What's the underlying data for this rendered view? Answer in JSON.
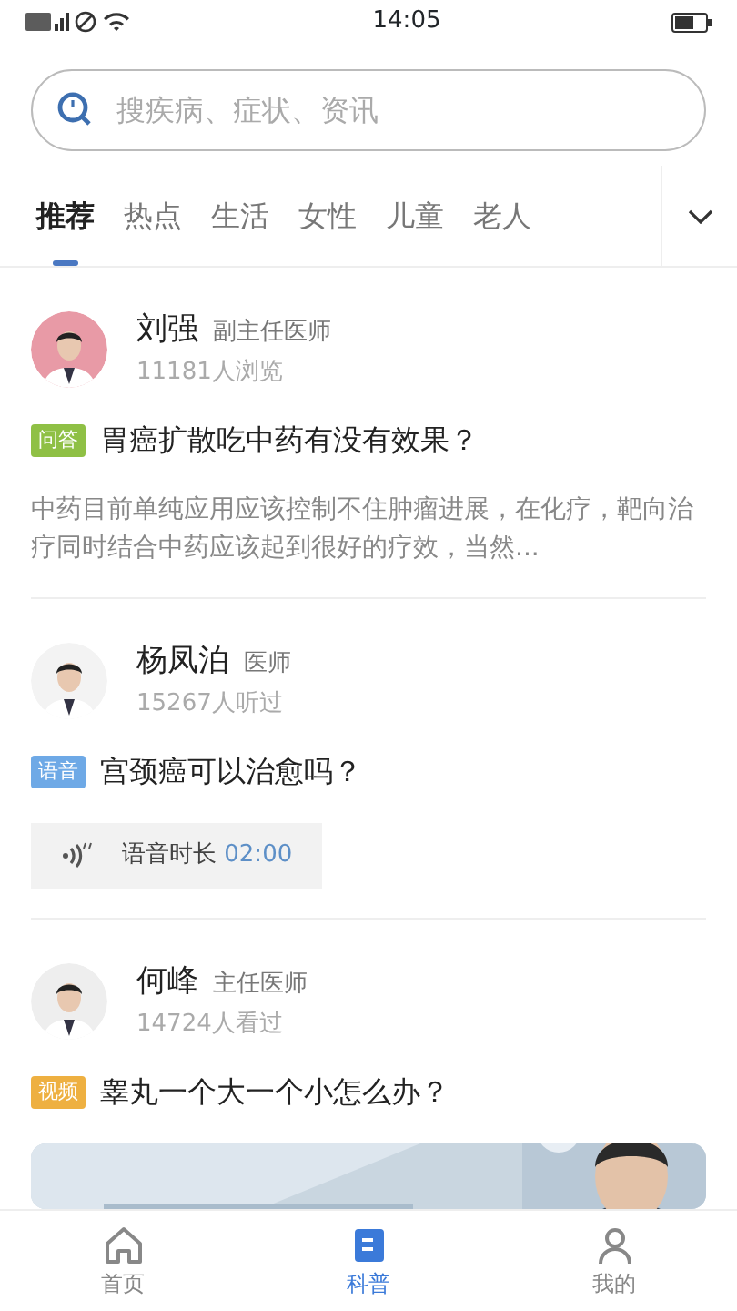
{
  "status_bar": {
    "time": "14:05"
  },
  "search": {
    "placeholder": "搜疾病、症状、资讯"
  },
  "tabs": [
    {
      "label": "推荐",
      "selected": true
    },
    {
      "label": "热点",
      "selected": false
    },
    {
      "label": "生活",
      "selected": false
    },
    {
      "label": "女性",
      "selected": false
    },
    {
      "label": "儿童",
      "selected": false
    },
    {
      "label": "老人",
      "selected": false
    }
  ],
  "feed": [
    {
      "kind": "qa",
      "doctor": "刘强",
      "title": "副主任医师",
      "views": "11181人浏览",
      "tag": "问答",
      "color": "#8fc045",
      "question": "胃癌扩散吃中药有没有效果？",
      "excerpt": "中药目前单纯应用应该控制不住肿瘤进展，在化疗，靶向治疗同时结合中药应该起到很好的疗效，当然..."
    },
    {
      "kind": "voice",
      "doctor": "杨凤泊",
      "title": "医师",
      "views": "15267人听过",
      "tag": "语音",
      "color": "#6ea9e6",
      "question": "宫颈癌可以治愈吗？",
      "voice_label": "语音时长",
      "duration": "02:00"
    },
    {
      "kind": "video",
      "doctor": "何峰",
      "title": "主任医师",
      "views": "14724人看过",
      "tag": "视频",
      "color": "#eeb041",
      "question": "睾丸一个大一个小怎么办？"
    }
  ],
  "bottom_nav": [
    {
      "label": "首页",
      "selected": false
    },
    {
      "label": "科普",
      "selected": true
    },
    {
      "label": "我的",
      "selected": false
    }
  ]
}
